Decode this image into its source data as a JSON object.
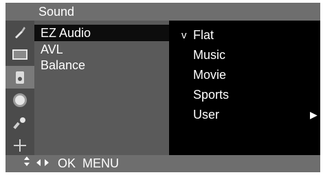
{
  "menu": {
    "title": "Sound"
  },
  "icons": [
    {
      "name": "picture-settings-icon",
      "glyph": "🖌"
    },
    {
      "name": "screen-icon",
      "glyph": ""
    },
    {
      "name": "sound-icon",
      "glyph": ""
    },
    {
      "name": "time-icon",
      "glyph": ""
    },
    {
      "name": "special-icon",
      "glyph": "🔑"
    },
    {
      "name": "position-icon",
      "glyph": "✢"
    }
  ],
  "main_items": [
    {
      "label": "EZ Audio",
      "active": true
    },
    {
      "label": "AVL",
      "active": false
    },
    {
      "label": "Balance",
      "active": false
    }
  ],
  "sub_items": [
    {
      "label": "Flat",
      "check": "v",
      "arrow": ""
    },
    {
      "label": "Music",
      "check": "",
      "arrow": ""
    },
    {
      "label": "Movie",
      "check": "",
      "arrow": ""
    },
    {
      "label": "Sports",
      "check": "",
      "arrow": ""
    },
    {
      "label": "User",
      "check": "",
      "arrow": "▶"
    }
  ],
  "footer": {
    "updown": "▲▼",
    "leftright": "◀▶",
    "ok": "OK",
    "menu": "MENU"
  }
}
